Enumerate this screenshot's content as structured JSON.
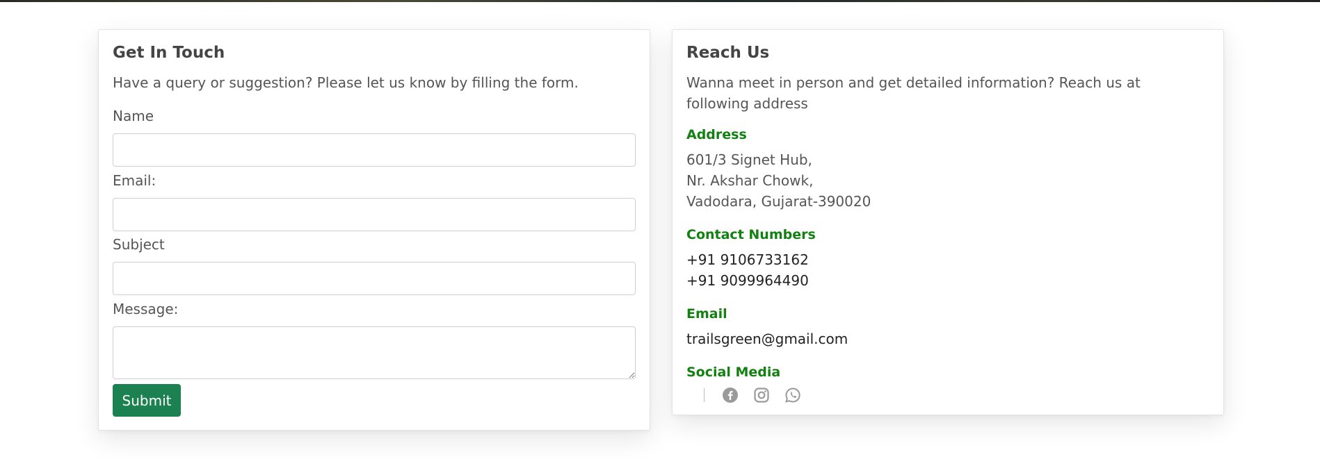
{
  "contact_form": {
    "title": "Get In Touch",
    "subtitle": "Have a query or suggestion? Please let us know by filling the form.",
    "fields": {
      "name": {
        "label": "Name",
        "value": "",
        "placeholder": ""
      },
      "email": {
        "label": "Email:",
        "value": "",
        "placeholder": ""
      },
      "subject": {
        "label": "Subject",
        "value": "",
        "placeholder": ""
      },
      "message": {
        "label": "Message:",
        "value": "",
        "placeholder": ""
      }
    },
    "submit_label": "Submit"
  },
  "reach_us": {
    "title": "Reach Us",
    "subtitle": "Wanna meet in person and get detailed information? Reach us at following address",
    "address": {
      "heading": "Address",
      "lines": [
        "601/3 Signet Hub,",
        "Nr. Akshar Chowk,",
        "Vadodara, Gujarat-390020"
      ]
    },
    "contact_numbers": {
      "heading": "Contact Numbers",
      "numbers": [
        "+91 9106733162",
        "+91 9099964490"
      ]
    },
    "email": {
      "heading": "Email",
      "value": "trailsgreen@gmail.com"
    },
    "social_media": {
      "heading": "Social Media",
      "icons": [
        "facebook-icon",
        "instagram-icon",
        "whatsapp-icon"
      ]
    }
  },
  "colors": {
    "accent_green": "#128112",
    "button_green": "#1b8150",
    "icon_grey": "#9a9a9a"
  }
}
